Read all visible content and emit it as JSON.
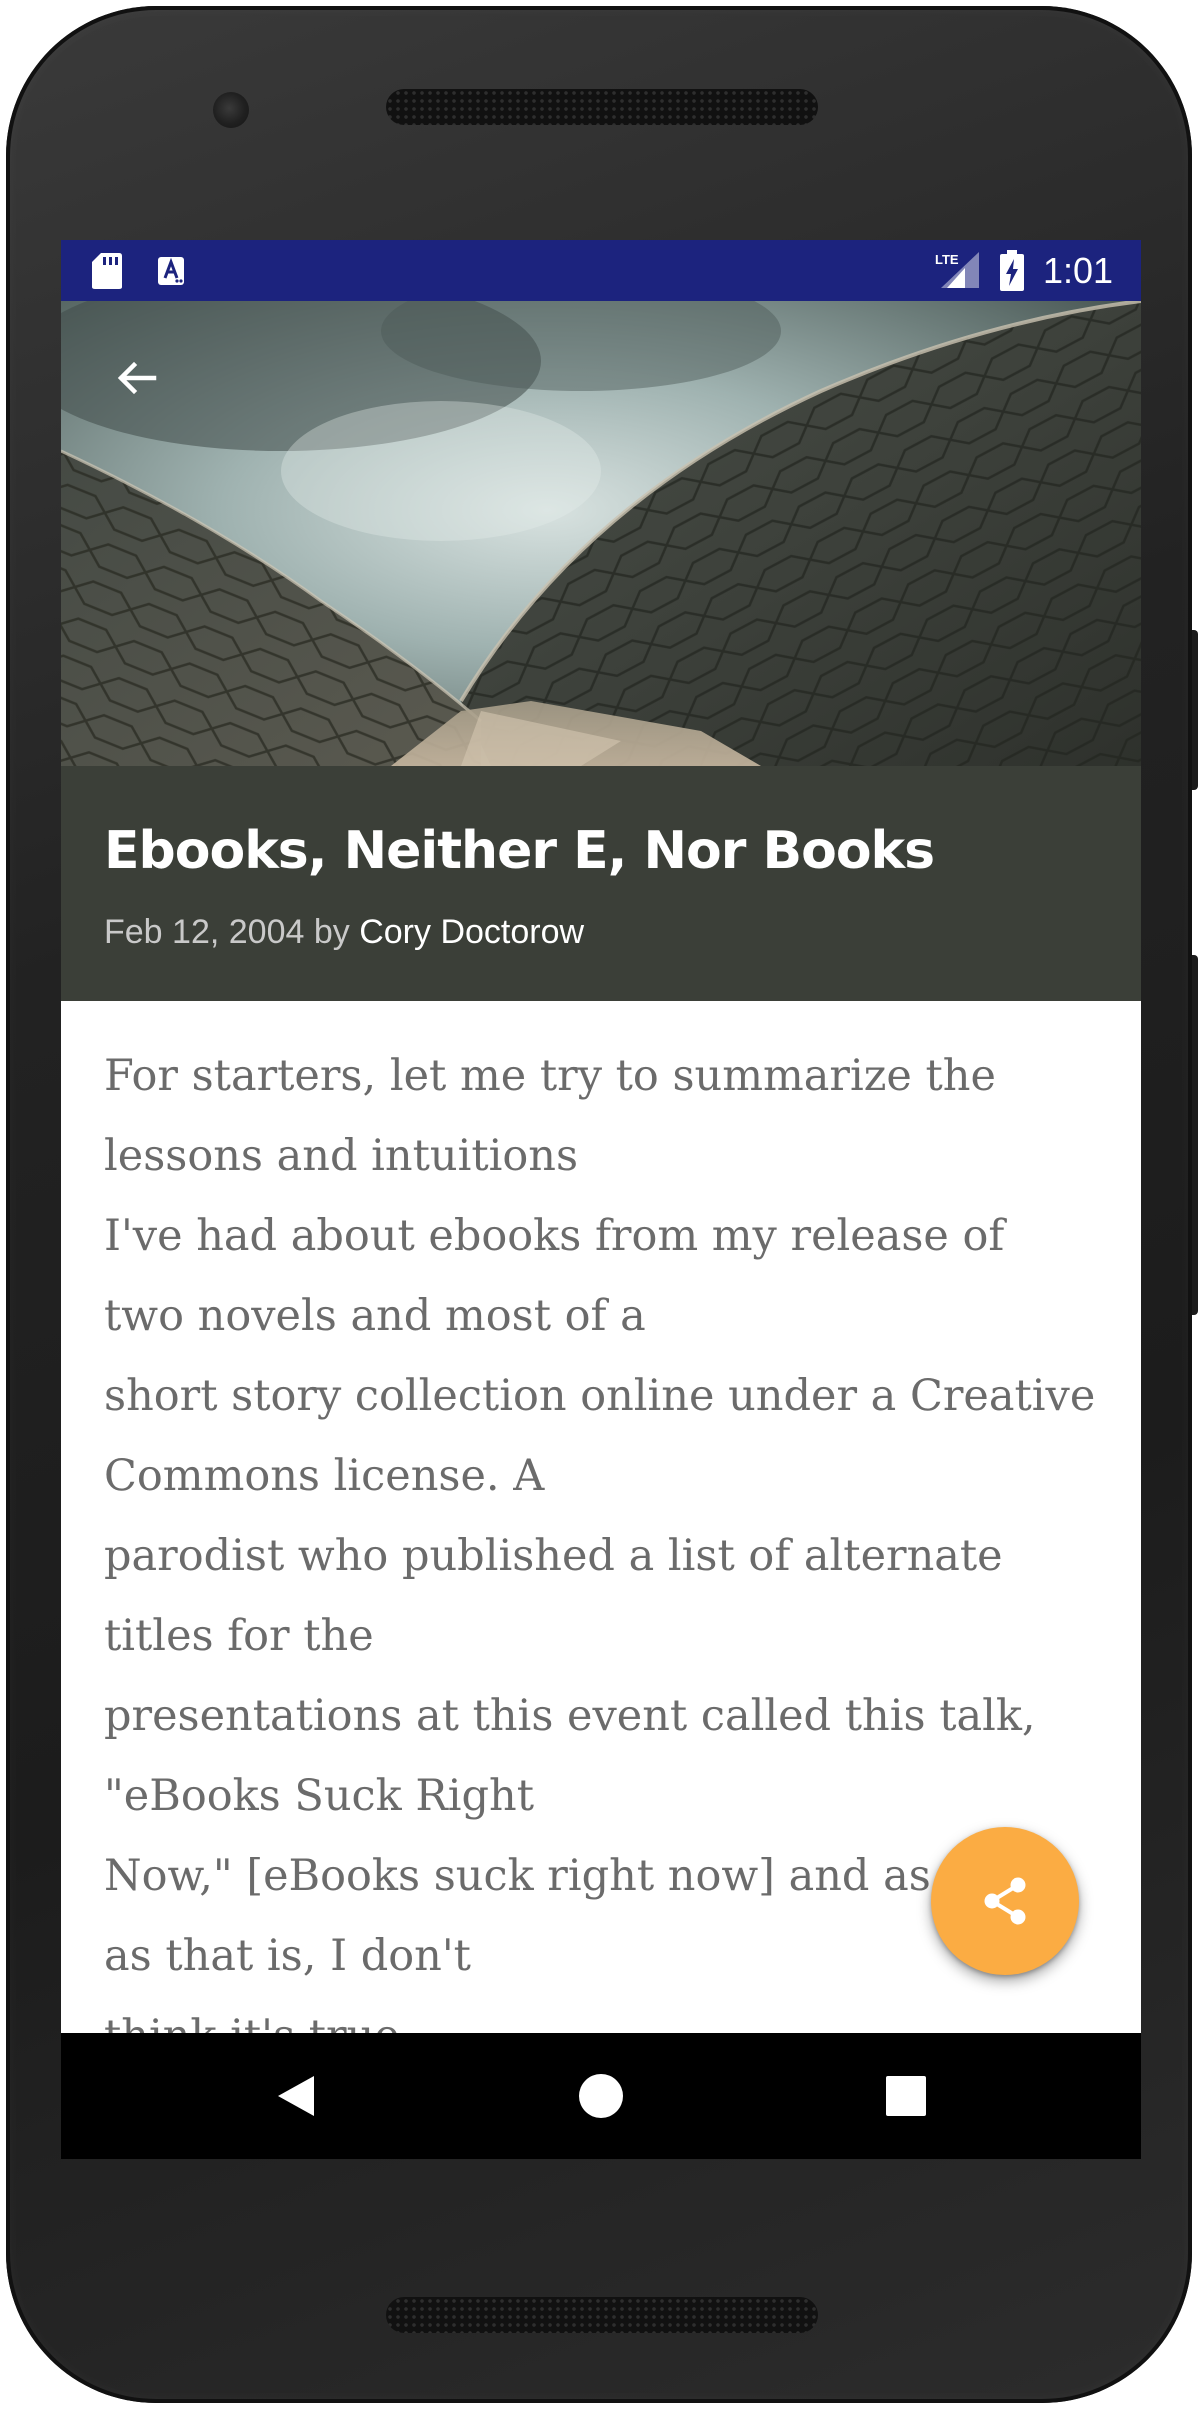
{
  "statusbar": {
    "time": "1:01",
    "color": "#1c237e",
    "icons": [
      "sd-card-icon",
      "a-notification-icon",
      "lte-signal-icon",
      "battery-charging-icon"
    ]
  },
  "hero": {
    "image": "opera-house-sails-photo",
    "back_icon": "arrow-back-icon"
  },
  "article": {
    "title": "Ebooks, Neither E, Nor Books",
    "date": "Feb 12, 2004",
    "by": "by",
    "author": "Cory Doctorow",
    "panel_color": "#3b3f38",
    "body": "For starters, let me try to summarize the\nlessons and intuitions\nI've had about ebooks from my release of\ntwo novels and most of a\nshort story collection online under a Creative\nCommons license. A\nparodist who published a list of alternate\ntitles for the\npresentations at this event called this talk,\n\"eBooks Suck Right\nNow,\" [eBooks suck right now] and as\nas that is, I don't\nthink it's true."
  },
  "fab": {
    "icon": "share-icon",
    "color": "#fbac43"
  },
  "navbar": {
    "icons": [
      "nav-back-icon",
      "nav-home-icon",
      "nav-recents-icon"
    ]
  }
}
